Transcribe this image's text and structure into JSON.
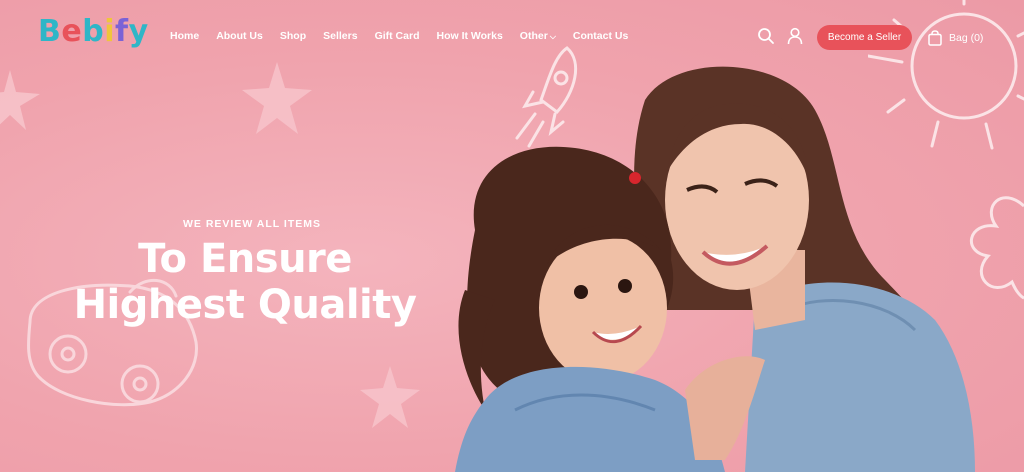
{
  "brand": {
    "logo_letters": [
      "B",
      "e",
      "b",
      "i",
      "f",
      "y"
    ],
    "logo_colors": [
      "#2fb6c7",
      "#e8525a",
      "#2fb6c7",
      "#f0c53b",
      "#7b62d6",
      "#2fb6c7"
    ]
  },
  "nav": {
    "items": [
      "Home",
      "About Us",
      "Shop",
      "Sellers",
      "Gift Card",
      "How It Works",
      "Other",
      "Contact Us"
    ]
  },
  "header": {
    "search_icon": "search-icon",
    "user_icon": "user-icon",
    "seller_button": "Become a Seller",
    "bag_label": "Bag (0)"
  },
  "hero": {
    "eyebrow": "WE REVIEW ALL ITEMS",
    "headline_line1": "To Ensure",
    "headline_line2": "Highest Quality"
  },
  "colors": {
    "background": "#f1a7b1",
    "accent": "#e8525a"
  }
}
